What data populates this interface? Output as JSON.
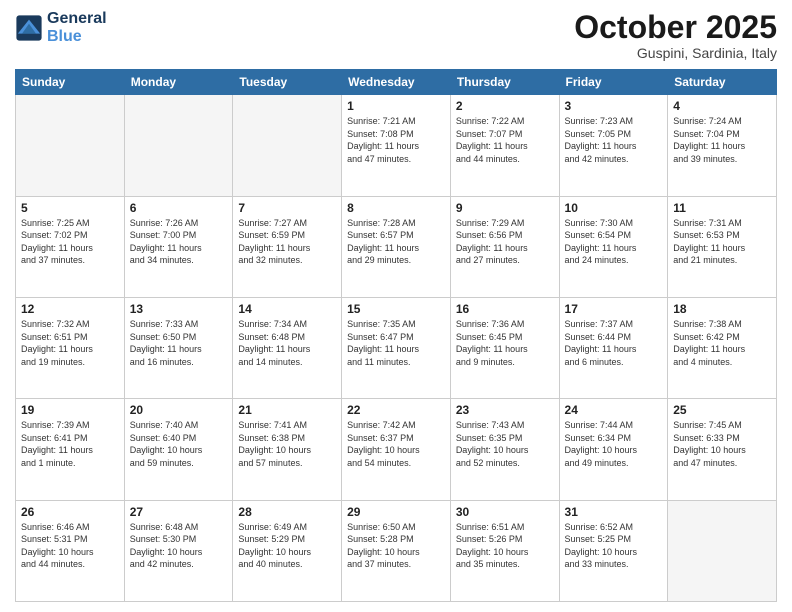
{
  "logo": {
    "line1": "General",
    "line2": "Blue"
  },
  "title": "October 2025",
  "location": "Guspini, Sardinia, Italy",
  "days_header": [
    "Sunday",
    "Monday",
    "Tuesday",
    "Wednesday",
    "Thursday",
    "Friday",
    "Saturday"
  ],
  "weeks": [
    [
      {
        "day": "",
        "info": ""
      },
      {
        "day": "",
        "info": ""
      },
      {
        "day": "",
        "info": ""
      },
      {
        "day": "1",
        "info": "Sunrise: 7:21 AM\nSunset: 7:08 PM\nDaylight: 11 hours\nand 47 minutes."
      },
      {
        "day": "2",
        "info": "Sunrise: 7:22 AM\nSunset: 7:07 PM\nDaylight: 11 hours\nand 44 minutes."
      },
      {
        "day": "3",
        "info": "Sunrise: 7:23 AM\nSunset: 7:05 PM\nDaylight: 11 hours\nand 42 minutes."
      },
      {
        "day": "4",
        "info": "Sunrise: 7:24 AM\nSunset: 7:04 PM\nDaylight: 11 hours\nand 39 minutes."
      }
    ],
    [
      {
        "day": "5",
        "info": "Sunrise: 7:25 AM\nSunset: 7:02 PM\nDaylight: 11 hours\nand 37 minutes."
      },
      {
        "day": "6",
        "info": "Sunrise: 7:26 AM\nSunset: 7:00 PM\nDaylight: 11 hours\nand 34 minutes."
      },
      {
        "day": "7",
        "info": "Sunrise: 7:27 AM\nSunset: 6:59 PM\nDaylight: 11 hours\nand 32 minutes."
      },
      {
        "day": "8",
        "info": "Sunrise: 7:28 AM\nSunset: 6:57 PM\nDaylight: 11 hours\nand 29 minutes."
      },
      {
        "day": "9",
        "info": "Sunrise: 7:29 AM\nSunset: 6:56 PM\nDaylight: 11 hours\nand 27 minutes."
      },
      {
        "day": "10",
        "info": "Sunrise: 7:30 AM\nSunset: 6:54 PM\nDaylight: 11 hours\nand 24 minutes."
      },
      {
        "day": "11",
        "info": "Sunrise: 7:31 AM\nSunset: 6:53 PM\nDaylight: 11 hours\nand 21 minutes."
      }
    ],
    [
      {
        "day": "12",
        "info": "Sunrise: 7:32 AM\nSunset: 6:51 PM\nDaylight: 11 hours\nand 19 minutes."
      },
      {
        "day": "13",
        "info": "Sunrise: 7:33 AM\nSunset: 6:50 PM\nDaylight: 11 hours\nand 16 minutes."
      },
      {
        "day": "14",
        "info": "Sunrise: 7:34 AM\nSunset: 6:48 PM\nDaylight: 11 hours\nand 14 minutes."
      },
      {
        "day": "15",
        "info": "Sunrise: 7:35 AM\nSunset: 6:47 PM\nDaylight: 11 hours\nand 11 minutes."
      },
      {
        "day": "16",
        "info": "Sunrise: 7:36 AM\nSunset: 6:45 PM\nDaylight: 11 hours\nand 9 minutes."
      },
      {
        "day": "17",
        "info": "Sunrise: 7:37 AM\nSunset: 6:44 PM\nDaylight: 11 hours\nand 6 minutes."
      },
      {
        "day": "18",
        "info": "Sunrise: 7:38 AM\nSunset: 6:42 PM\nDaylight: 11 hours\nand 4 minutes."
      }
    ],
    [
      {
        "day": "19",
        "info": "Sunrise: 7:39 AM\nSunset: 6:41 PM\nDaylight: 11 hours\nand 1 minute."
      },
      {
        "day": "20",
        "info": "Sunrise: 7:40 AM\nSunset: 6:40 PM\nDaylight: 10 hours\nand 59 minutes."
      },
      {
        "day": "21",
        "info": "Sunrise: 7:41 AM\nSunset: 6:38 PM\nDaylight: 10 hours\nand 57 minutes."
      },
      {
        "day": "22",
        "info": "Sunrise: 7:42 AM\nSunset: 6:37 PM\nDaylight: 10 hours\nand 54 minutes."
      },
      {
        "day": "23",
        "info": "Sunrise: 7:43 AM\nSunset: 6:35 PM\nDaylight: 10 hours\nand 52 minutes."
      },
      {
        "day": "24",
        "info": "Sunrise: 7:44 AM\nSunset: 6:34 PM\nDaylight: 10 hours\nand 49 minutes."
      },
      {
        "day": "25",
        "info": "Sunrise: 7:45 AM\nSunset: 6:33 PM\nDaylight: 10 hours\nand 47 minutes."
      }
    ],
    [
      {
        "day": "26",
        "info": "Sunrise: 6:46 AM\nSunset: 5:31 PM\nDaylight: 10 hours\nand 44 minutes."
      },
      {
        "day": "27",
        "info": "Sunrise: 6:48 AM\nSunset: 5:30 PM\nDaylight: 10 hours\nand 42 minutes."
      },
      {
        "day": "28",
        "info": "Sunrise: 6:49 AM\nSunset: 5:29 PM\nDaylight: 10 hours\nand 40 minutes."
      },
      {
        "day": "29",
        "info": "Sunrise: 6:50 AM\nSunset: 5:28 PM\nDaylight: 10 hours\nand 37 minutes."
      },
      {
        "day": "30",
        "info": "Sunrise: 6:51 AM\nSunset: 5:26 PM\nDaylight: 10 hours\nand 35 minutes."
      },
      {
        "day": "31",
        "info": "Sunrise: 6:52 AM\nSunset: 5:25 PM\nDaylight: 10 hours\nand 33 minutes."
      },
      {
        "day": "",
        "info": ""
      }
    ]
  ]
}
